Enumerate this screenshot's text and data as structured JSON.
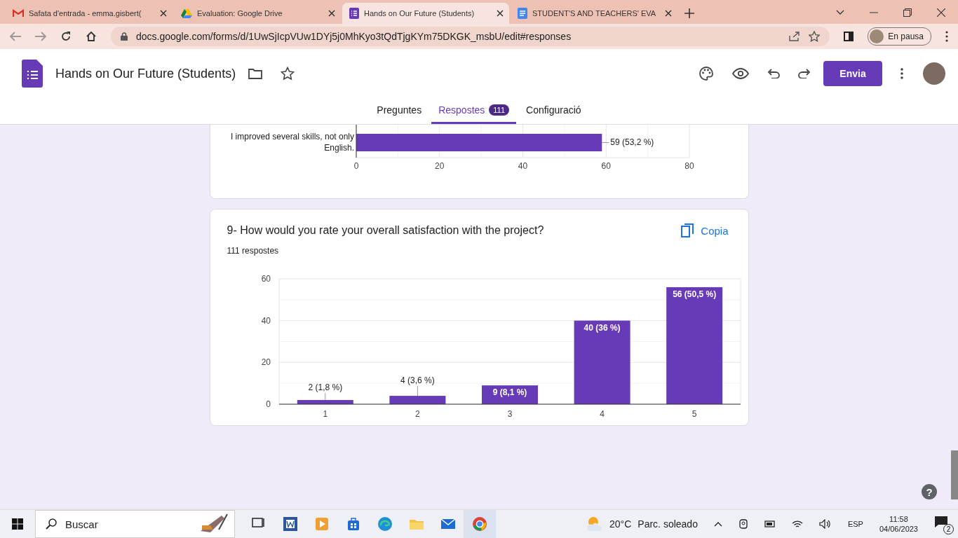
{
  "browser": {
    "tabs": [
      {
        "kind": "mail",
        "title": "Safata d'entrada - emma.gisbert(",
        "selected": false
      },
      {
        "kind": "drive",
        "title": "Evaluation: Google Drive",
        "selected": false
      },
      {
        "kind": "form",
        "title": "Hands on Our Future (Students)",
        "selected": true
      },
      {
        "kind": "doc",
        "title": "STUDENT'S AND TEACHERS' EVA",
        "selected": false
      }
    ],
    "address": "docs.google.com/forms/d/1UwSjIcpVUw1DYj5j0MhKyo3tQdTjgKYm75DKGK_msbU/edit#responses",
    "profile_label": "En pausa"
  },
  "form_header": {
    "title": "Hands on Our Future (Students)",
    "send_button": "Envia",
    "tabs": [
      {
        "label": "Preguntes",
        "selected": false
      },
      {
        "label": "Respostes",
        "selected": true,
        "badge": "111"
      },
      {
        "label": "Configuració",
        "selected": false
      }
    ]
  },
  "partial_card": {
    "chart_data": {
      "type": "bar",
      "orientation": "horizontal",
      "categories": [
        "I improved several skills, not only English."
      ],
      "values": [
        59
      ],
      "xlim": [
        0,
        80
      ],
      "xticks": [
        0,
        20,
        40,
        60,
        80
      ],
      "grid": true,
      "value_labels": [
        "59 (53,2 %)"
      ]
    }
  },
  "question_card": {
    "title": "9- How would you rate your overall satisfaction with the project?",
    "copy_button": "Copia",
    "response_count": "111 respostes",
    "chart_data": {
      "type": "bar",
      "orientation": "vertical",
      "categories": [
        "1",
        "2",
        "3",
        "4",
        "5"
      ],
      "values": [
        2,
        4,
        9,
        40,
        56
      ],
      "ylim": [
        0,
        60
      ],
      "yticks": [
        0,
        20,
        40,
        60
      ],
      "grid": true,
      "value_labels": [
        "2 (1,8 %)",
        "4 (3,6 %)",
        "9 (8,1 %)",
        "40 (36 %)",
        "56 (50,5 %)"
      ]
    }
  },
  "help_button": "?",
  "taskbar": {
    "search_placeholder": "Buscar",
    "temperature": "20°C",
    "weather": "Parc. soleado",
    "language": "ESP",
    "time": "11:58",
    "date": "04/06/2023",
    "notifications": "2"
  }
}
